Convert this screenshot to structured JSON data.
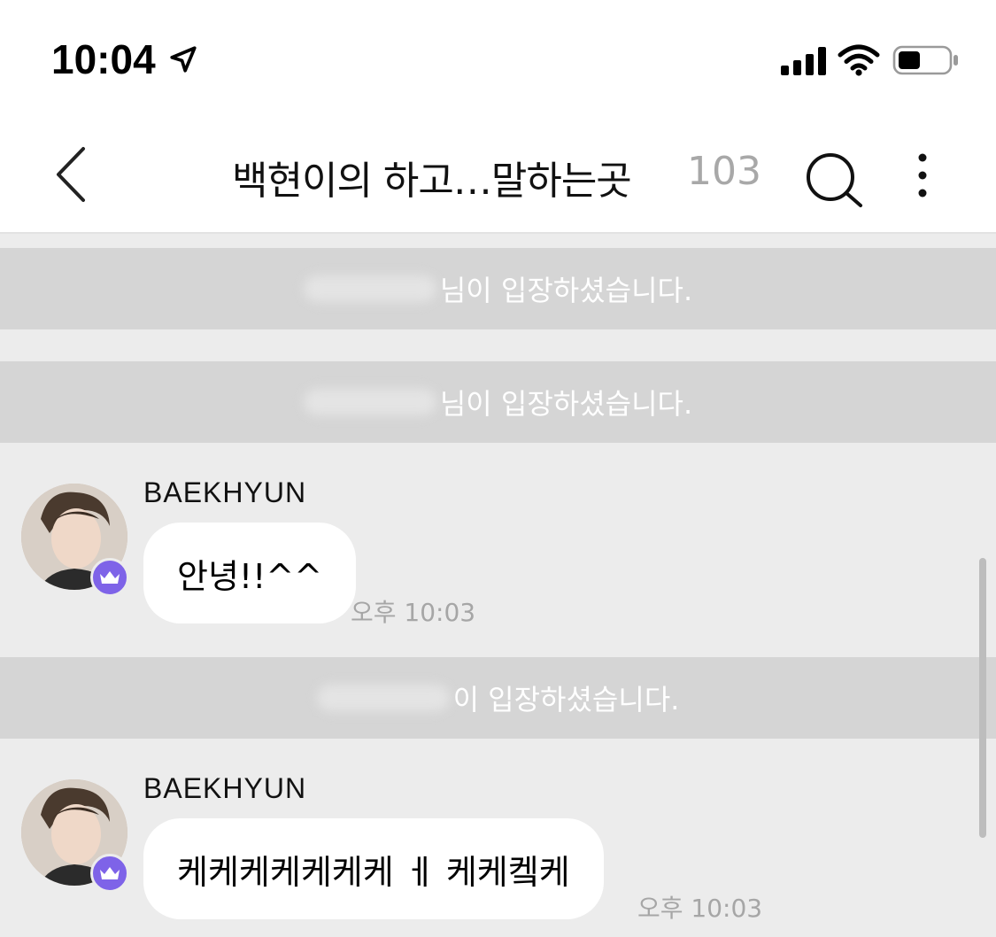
{
  "status_bar": {
    "time": "10:04",
    "icons": [
      "location-arrow-icon",
      "cellular-signal-icon",
      "wifi-icon",
      "battery-icon"
    ]
  },
  "header": {
    "title": "백현이의 하고…말하는곳",
    "member_count": "103",
    "icons": [
      "back-chevron-icon",
      "search-icon",
      "more-vertical-icon"
    ]
  },
  "notices": [
    {
      "text": "님이 입장하셨습니다."
    },
    {
      "text": "님이 입장하셨습니다."
    },
    {
      "text": "이 입장하셨습니다."
    }
  ],
  "messages": [
    {
      "sender": "BAEKHYUN",
      "text": "안녕!!^^",
      "time": "오후 10:03"
    },
    {
      "sender": "BAEKHYUN",
      "text": "케케케케케케케 ㅔ 케케켘케",
      "time": "오후 10:03"
    }
  ],
  "colors": {
    "chat_background": "#ececec",
    "notice_background": "#d5d5d5",
    "bubble": "#ffffff",
    "crown_badge": "#7e63e8",
    "muted_text": "#a6a6a6"
  }
}
